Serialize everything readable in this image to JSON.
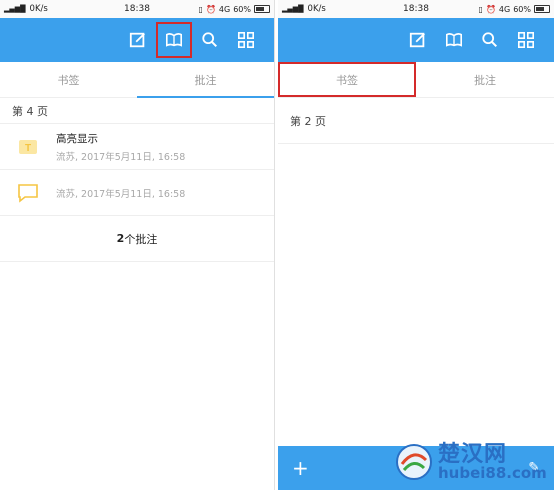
{
  "colors": {
    "accent": "#3ba0ec",
    "highlight_box": "#d42a2a",
    "note_icon": "#f5c542",
    "muted_text": "#a8a8a8"
  },
  "statusbar": {
    "network": "4G",
    "speed": "0K/s",
    "time": "18:38",
    "network_right": "4G",
    "battery": "60%"
  },
  "toolbar": {
    "icons": [
      "edit-icon",
      "book-icon",
      "search-icon",
      "grid-icon"
    ]
  },
  "left": {
    "tabs": [
      {
        "label": "书签"
      },
      {
        "label": "批注",
        "active": true
      }
    ],
    "page_header": "第 4 页",
    "notes": [
      {
        "icon": "text-highlight-icon",
        "title": "高亮显示",
        "meta": "流苏, 2017年5月11日, 16:58"
      },
      {
        "icon": "comment-bubble-icon",
        "title": "",
        "meta": "流苏, 2017年5月11日, 16:58"
      }
    ],
    "count_prefix": "2",
    "count_suffix": " 个批注"
  },
  "right": {
    "tabs": [
      {
        "label": "书签"
      },
      {
        "label": "批注"
      }
    ],
    "bookmark": "第 2 页",
    "bottom_add": "+"
  },
  "watermark": {
    "cn": "楚汉网",
    "url": "hubei88.com"
  }
}
